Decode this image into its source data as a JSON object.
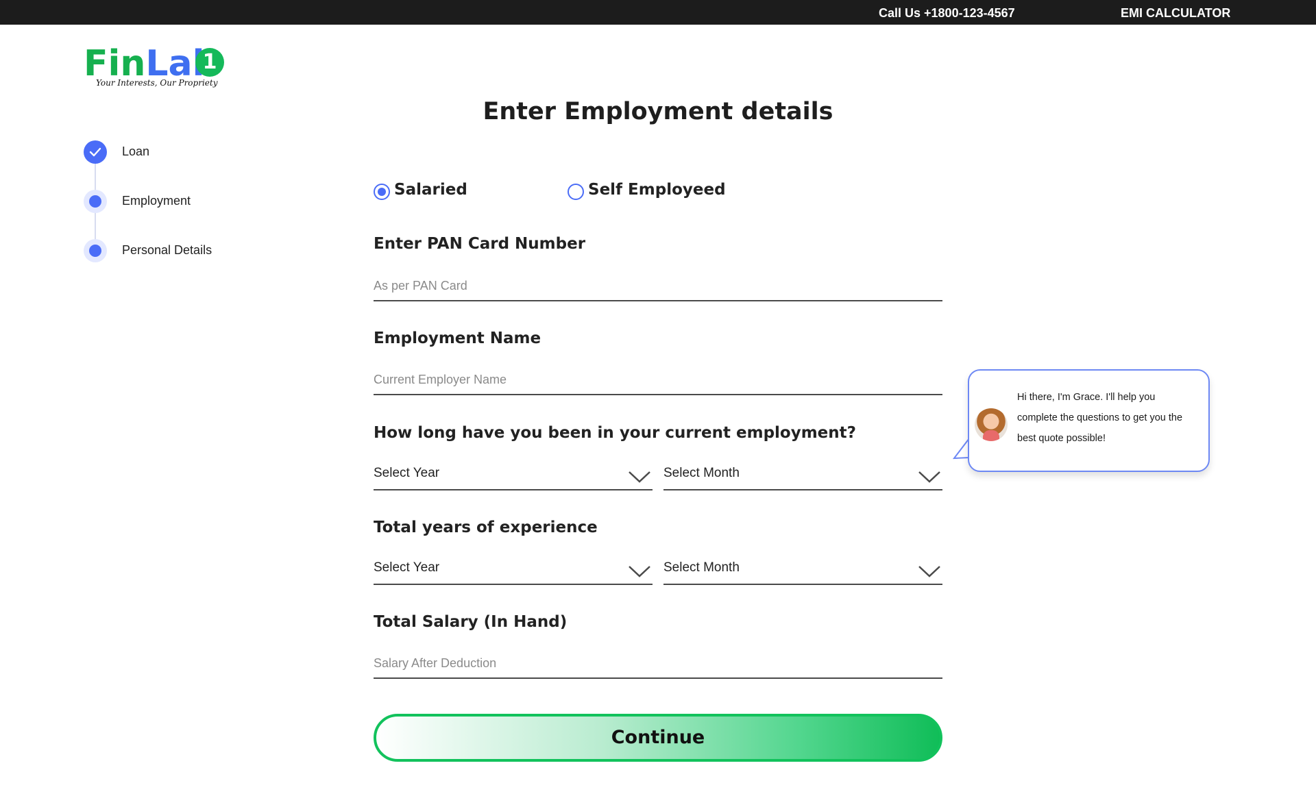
{
  "topbar": {
    "call_text": "Call Us +1800-123-4567",
    "emi_label": "EMI CALCULATOR"
  },
  "logo": {
    "fin": "Fin",
    "lab": "Lab",
    "one": "1",
    "tagline": "Your Interests, Our Propriety"
  },
  "stepper": {
    "steps": [
      {
        "label": "Loan",
        "state": "done"
      },
      {
        "label": "Employment",
        "state": "current"
      },
      {
        "label": "Personal Details",
        "state": "pending"
      }
    ]
  },
  "form": {
    "title": "Enter Employment details",
    "employment_type": {
      "options": [
        "Salaried",
        "Self Employeed"
      ],
      "selected": "Salaried"
    },
    "pan": {
      "label": "Enter PAN Card Number",
      "placeholder": "As per PAN Card"
    },
    "employer": {
      "label": "Employment Name",
      "placeholder": "Current Employer Name"
    },
    "current_employment": {
      "label": "How long have you been in your current employment?",
      "year_value": "Select Year",
      "month_value": "Select Month"
    },
    "total_experience": {
      "label": "Total years of experience",
      "year_value": "Select Year",
      "month_value": "Select Month"
    },
    "salary": {
      "label": "Total Salary (In Hand)",
      "placeholder": "Salary After Deduction"
    },
    "continue_label": "Continue"
  },
  "assistant": {
    "message": "Hi there, I'm Grace. I'll help you complete the questions to get you the best quote possible!"
  },
  "colors": {
    "accent": "#4a6cf7",
    "brand_green": "#16b04f",
    "topbar_bg": "#1c1c1c"
  },
  "icons": [
    "check-icon",
    "chevron-down-icon",
    "avatar"
  ]
}
